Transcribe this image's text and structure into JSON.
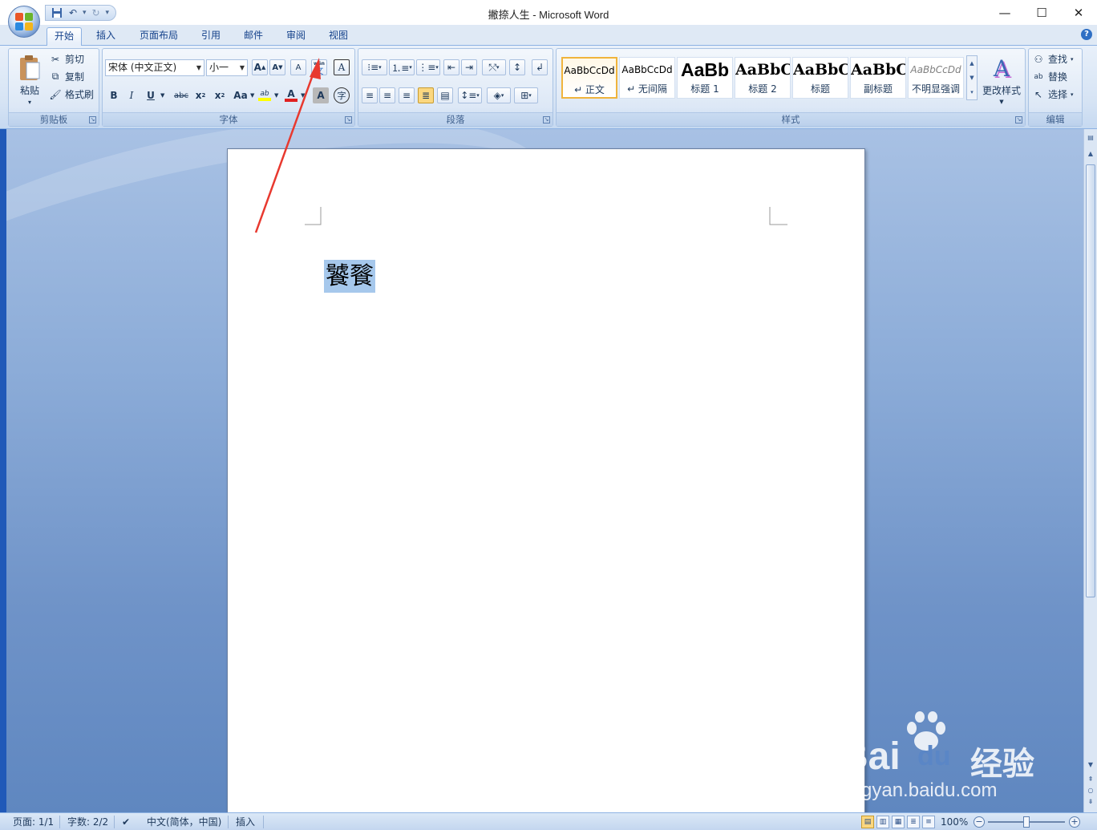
{
  "app": {
    "window_title": "撇捺人生 - Microsoft Word"
  },
  "qat": {
    "save_icon": "save-icon",
    "undo_icon": "undo-icon",
    "redo_icon": "redo-icon"
  },
  "tabs": [
    {
      "label": "开始",
      "active": true
    },
    {
      "label": "插入"
    },
    {
      "label": "页面布局"
    },
    {
      "label": "引用"
    },
    {
      "label": "邮件"
    },
    {
      "label": "审阅"
    },
    {
      "label": "视图"
    }
  ],
  "clipboard": {
    "label": "剪贴板",
    "paste": "粘贴",
    "cut": "剪切",
    "copy": "复制",
    "format_painter": "格式刷"
  },
  "font": {
    "label": "字体",
    "font_name": "宋体 (中文正文)",
    "font_size": "小一",
    "phonetic_glyph": "文",
    "phonetic_ruby": "wén",
    "grow_glyph": "A",
    "shrink_glyph": "A",
    "clear_glyph": "A",
    "border_glyph": "A",
    "bold": "B",
    "italic": "I",
    "underline": "U",
    "strike": "abc",
    "subscript": "x",
    "superscript": "x",
    "case": "Aa",
    "highlight": "ab",
    "font_color": "A",
    "char_shade": "A",
    "enclose": "字",
    "font_color_hex": "#e02020",
    "highlight_hex": "#ffff00"
  },
  "paragraph": {
    "label": "段落"
  },
  "styles": {
    "label": "样式",
    "items": [
      {
        "sample": "AaBbCcDd",
        "name": "↵ 正文",
        "selected": true
      },
      {
        "sample": "AaBbCcDd",
        "name": "↵ 无间隔"
      },
      {
        "sample": "AaBb",
        "name": "标题 1"
      },
      {
        "sample": "AaBbC",
        "name": "标题 2"
      },
      {
        "sample": "AaBbC",
        "name": "标题"
      },
      {
        "sample": "AaBbC",
        "name": "副标题"
      },
      {
        "sample": "AaBbCcDd",
        "name": "不明显强调"
      }
    ],
    "change_styles": "更改样式"
  },
  "editing": {
    "label": "编辑",
    "find": "查找",
    "replace": "替换",
    "select": "选择"
  },
  "document": {
    "selected_text": "饕餮"
  },
  "status": {
    "page": "页面: 1/1",
    "words": "字数: 2/2",
    "language": "中文(简体，中国)",
    "mode": "插入",
    "zoom": "100%"
  },
  "watermark": {
    "brand": "Bai",
    "brand2": "du",
    "suffix": "经验",
    "url": "jingyan.baidu.com"
  },
  "colors": {
    "annotation_arrow": "#e8392f",
    "selection": "#a6c8ec",
    "style_selected_border": "#f0b43c"
  }
}
